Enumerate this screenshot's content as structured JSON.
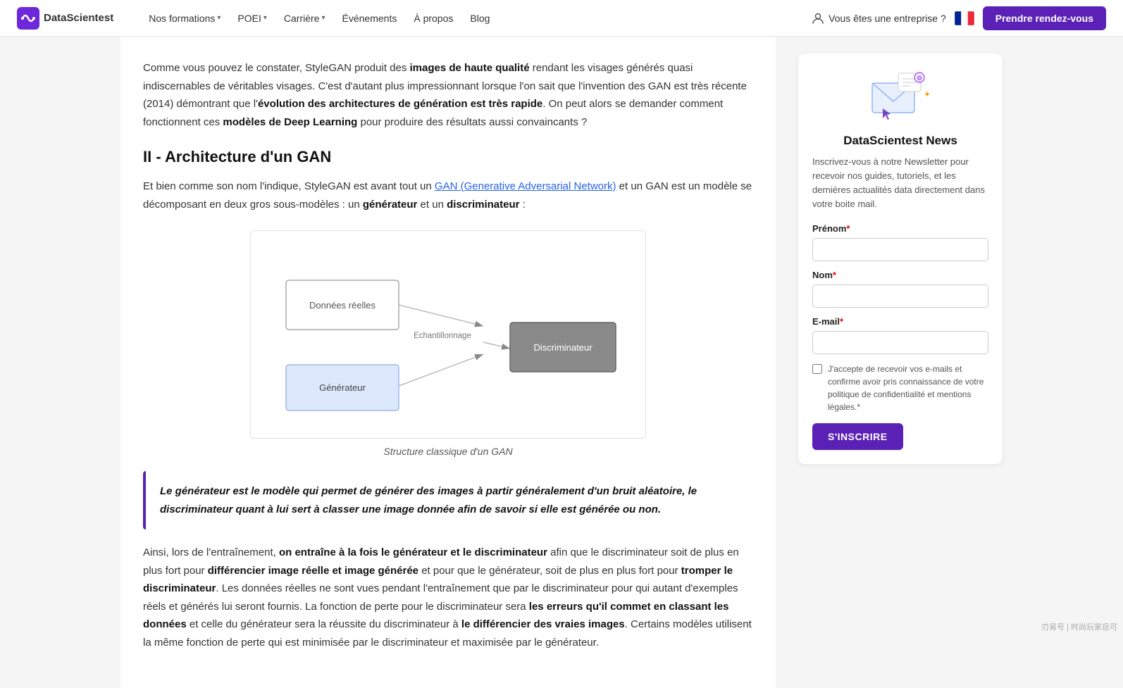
{
  "navbar": {
    "logo_text": "DataScientest",
    "nav_items": [
      {
        "label": "Nos formations",
        "has_chevron": true
      },
      {
        "label": "POEI",
        "has_chevron": true
      },
      {
        "label": "Carrière",
        "has_chevron": true
      },
      {
        "label": "Événements",
        "has_chevron": false
      },
      {
        "label": "À propos",
        "has_chevron": false
      },
      {
        "label": "Blog",
        "has_chevron": false
      }
    ],
    "enterprise_label": "Vous êtes une entreprise ?",
    "cta_label": "Prendre rendez-vous"
  },
  "article": {
    "intro_p1_plain": "Comme vous pouvez le constater, StyleGAN produit des ",
    "intro_p1_bold": "images de haute qualité",
    "intro_p1_rest": " rendant les visages générés quasi indiscernables de véritables visages. C'est d'autant plus impressionnant lorsque l'on sait que l'invention des GAN est très récente (2014) démontrant que l'",
    "intro_p1_bold2": "évolution des architectures de génération est très rapide",
    "intro_p1_end": ". On peut alors se demander comment fonctionnent ces ",
    "intro_p1_bold3": "modèles de Deep Learning",
    "intro_p1_final": " pour produire des résultats aussi convaincants ?",
    "section_heading": "II - Architecture d'un GAN",
    "section_p1_start": "Et bien comme son nom l'indique, StyleGAN est avant tout un ",
    "section_p1_link": "GAN (Generative Adversarial Network)",
    "section_p1_mid": " et un GAN est un modèle se décomposant en deux gros sous-modèles : un ",
    "section_p1_bold1": "générateur",
    "section_p1_and": " et un ",
    "section_p1_bold2": "discriminateur",
    "section_p1_end": " :",
    "diagram_caption": "Structure classique d'un GAN",
    "diagram_nodes": {
      "donnees_reelles": "Données réelles",
      "echantillonnage": "Echantillonnage",
      "discriminateur": "Discriminateur",
      "generateur": "Générateur"
    },
    "quote": "Le générateur est le modèle qui permet de générer des images à partir généralement d'un bruit aléatoire, le discriminateur quant à lui sert à classer une image donnée afin de savoir si elle est générée ou non.",
    "body_p1_start": "Ainsi, lors de l'entraînement, ",
    "body_p1_bold1": "on entraîne à la fois le générateur et le discriminateur",
    "body_p1_mid": " afin que le discriminateur soit de plus en plus fort pour ",
    "body_p1_bold2": "différencier image réelle et image générée",
    "body_p1_mid2": " et pour que le générateur, soit de plus en plus fort pour ",
    "body_p1_bold3": "tromper le discriminateur",
    "body_p1_rest": ". Les données réelles ne sont vues pendant l'entraînement que par le discriminateur pour qui autant d'exemples réels et générés lui seront fournis. La fonction de perte pour le discriminateur sera ",
    "body_p1_bold4": "les erreurs qu'il commet en classant les données",
    "body_p1_rest2": " et celle du générateur sera la réussite du discriminateur à ",
    "body_p1_bold5": "le différencier des vraies images",
    "body_p1_end": ". Certains modèles utilisent la même fonction de perte qui est minimisée par le discriminateur et maximisée par le générateur."
  },
  "sidebar": {
    "title": "DataScientest News",
    "description": "Inscrivez-vous à notre Newsletter pour recevoir nos guides, tutoriels, et les dernières actualités data directement dans votre boite mail.",
    "prenom_label": "Prénom",
    "prenom_req": "*",
    "nom_label": "Nom",
    "nom_req": "*",
    "email_label": "E-mail",
    "email_req": "*",
    "checkbox_text": "J'accepte de recevoir vos e-mails et confirme avoir pris connaissance de votre politique de confidentialité et mentions légales.",
    "checkbox_req": "*",
    "submit_label": "S'INSCRIRE"
  },
  "watermark": "刃易号 | 时尚玩家岳可"
}
